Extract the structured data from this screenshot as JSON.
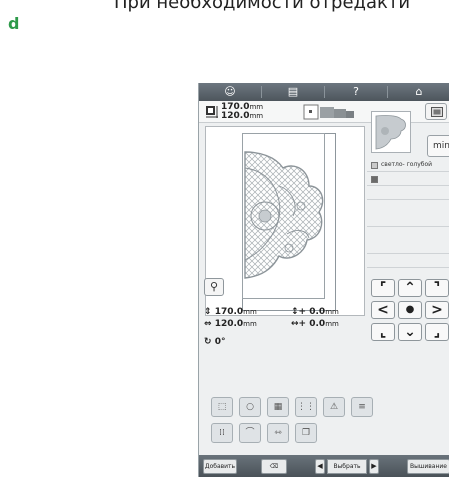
{
  "step_letter": "d",
  "caption": "При необходимости отредакти",
  "screen": {
    "topbar": {
      "info_icon": "☺",
      "page_icon": "▤",
      "help_label": "?",
      "home_icon": "⌂"
    },
    "size": {
      "height_value": "170.0",
      "height_unit": "mm",
      "width_value": "120.0",
      "width_unit": "mm"
    },
    "min_button_label": "min",
    "color_list": {
      "color_name": "светло- голубой",
      "colors": [
        "#c9c9c9",
        "#6b6b6b"
      ]
    },
    "arrows": {
      "up_left": "⌜",
      "up": "⌃",
      "up_right": "⌝",
      "left": "<",
      "center": "●",
      "right": ">",
      "down_left": "⌞",
      "down": "⌄",
      "down_right": "⌟"
    },
    "readouts": {
      "height_value": "170.0",
      "height_unit": "mm",
      "vertical_offset": "0.0",
      "vertical_unit": "mm",
      "width_value": "120.0",
      "width_unit": "mm",
      "horizontal_offset": "0.0",
      "horizontal_unit": "mm",
      "rotation": "0°"
    },
    "bottombar": {
      "add_label": "Добавить",
      "select_label": "Выбрать",
      "finish_label": "Вышивание"
    }
  }
}
